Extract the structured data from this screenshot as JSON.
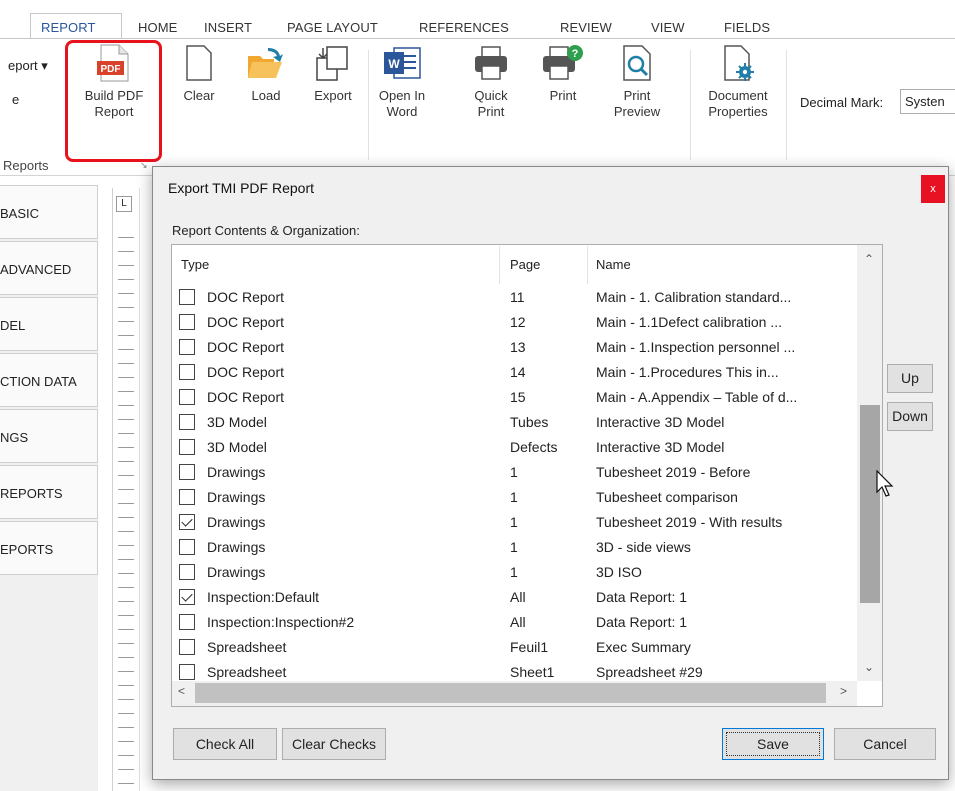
{
  "ribbon": {
    "tabs": [
      "REPORT",
      "HOME",
      "INSERT",
      "PAGE LAYOUT",
      "REFERENCES",
      "REVIEW",
      "VIEW",
      "FIELDS"
    ],
    "partial_left": [
      "eport",
      "e"
    ],
    "buttons": {
      "build_pdf": "Build PDF\nReport",
      "clear": "Clear",
      "load": "Load",
      "export": "Export",
      "open_word": "Open In\nWord",
      "quick_print": "Quick\nPrint",
      "print": "Print",
      "print_preview": "Print\nPreview",
      "doc_props": "Document\nProperties"
    },
    "pdf_badge": "PDF",
    "word_badge": "W",
    "decimal_mark_label": "Decimal Mark:",
    "decimal_mark_value": "Systen",
    "groups": [
      "Reports"
    ]
  },
  "side_tabs": [
    "BASIC",
    "ADVANCED",
    "DEL",
    "CTION DATA",
    "NGS",
    "REPORTS",
    "EPORTS"
  ],
  "dialog": {
    "title": "Export TMI PDF Report",
    "close_label": "x",
    "section_label": "Report Contents & Organization:",
    "columns": [
      "Type",
      "Page",
      "Name"
    ],
    "rows": [
      {
        "checked": false,
        "type": "DOC Report",
        "page": "11",
        "name": "Main - 1. Calibration standard..."
      },
      {
        "checked": false,
        "type": "DOC Report",
        "page": "12",
        "name": "Main - 1.1Defect calibration  ..."
      },
      {
        "checked": false,
        "type": "DOC Report",
        "page": "13",
        "name": "Main - 1.Inspection personnel ..."
      },
      {
        "checked": false,
        "type": "DOC Report",
        "page": "14",
        "name": "Main - 1.Procedures   This in..."
      },
      {
        "checked": false,
        "type": "DOC Report",
        "page": "15",
        "name": "Main - A.Appendix – Table of d..."
      },
      {
        "checked": false,
        "type": "3D Model",
        "page": "Tubes",
        "name": "Interactive 3D Model"
      },
      {
        "checked": false,
        "type": "3D Model",
        "page": "Defects",
        "name": "Interactive 3D Model"
      },
      {
        "checked": false,
        "type": "Drawings",
        "page": "1",
        "name": "Tubesheet 2019 - Before"
      },
      {
        "checked": false,
        "type": "Drawings",
        "page": "1",
        "name": "Tubesheet comparison"
      },
      {
        "checked": true,
        "type": "Drawings",
        "page": "1",
        "name": "Tubesheet 2019 - With results"
      },
      {
        "checked": false,
        "type": "Drawings",
        "page": "1",
        "name": "3D - side views"
      },
      {
        "checked": false,
        "type": "Drawings",
        "page": "1",
        "name": "3D ISO"
      },
      {
        "checked": true,
        "type": "Inspection:Default",
        "page": "All",
        "name": "Data Report: 1"
      },
      {
        "checked": false,
        "type": "Inspection:Inspection#2",
        "page": "All",
        "name": "Data Report: 1"
      },
      {
        "checked": false,
        "type": "Spreadsheet",
        "page": "Feuil1",
        "name": "Exec Summary"
      },
      {
        "checked": false,
        "type": "Spreadsheet",
        "page": "Sheet1",
        "name": "Spreadsheet #29"
      }
    ],
    "up_label": "Up",
    "down_label": "Down",
    "check_all_label": "Check All",
    "clear_checks_label": "Clear Checks",
    "save_label": "Save",
    "cancel_label": "Cancel"
  },
  "colors": {
    "accent": "#2b579a",
    "highlight": "#e8121c",
    "close": "#e81123",
    "pdf_red": "#d9412b",
    "folder_orange": "#f0a830",
    "word_blue": "#2b579a",
    "teal": "#1e7fa8"
  }
}
